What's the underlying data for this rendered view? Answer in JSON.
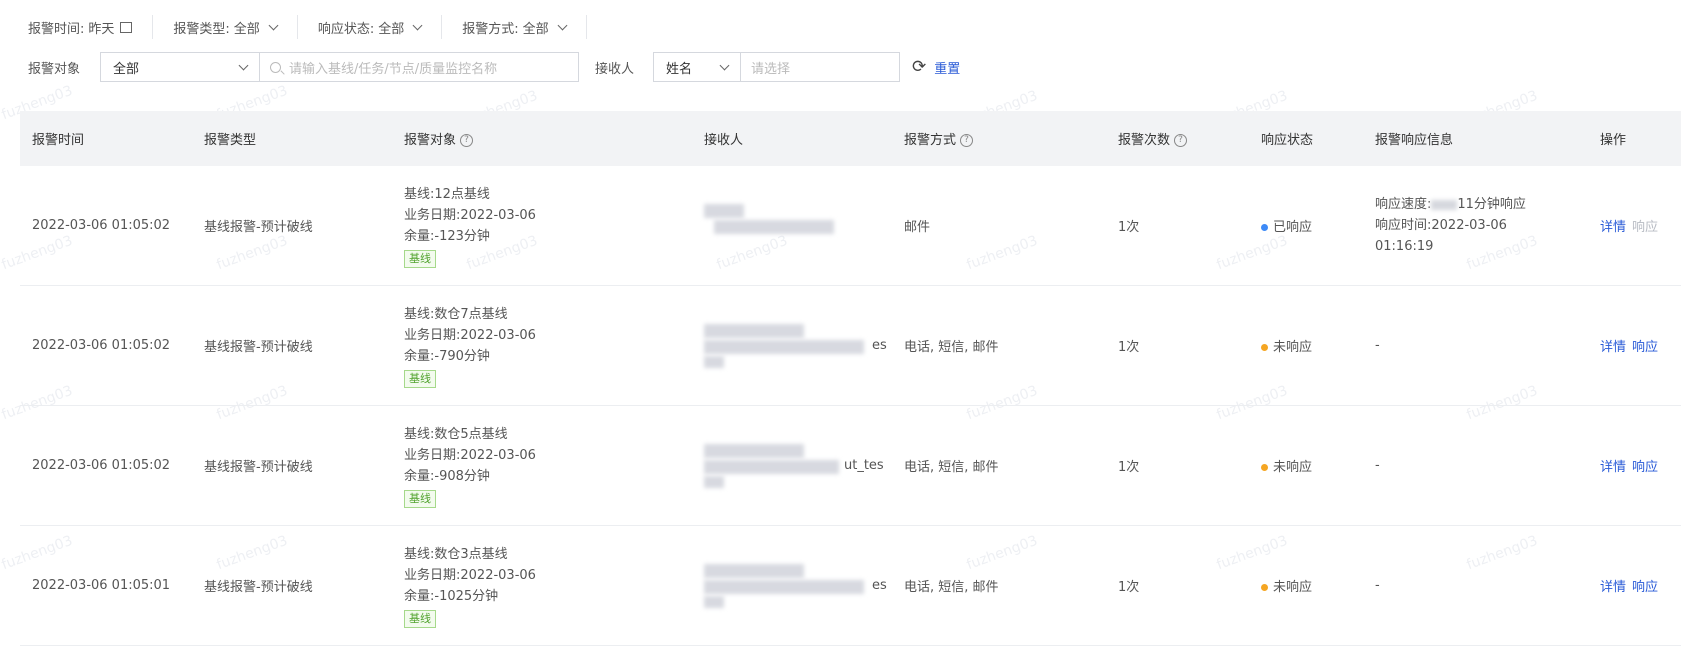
{
  "filters": {
    "time": {
      "label": "报警时间:",
      "value": "昨天"
    },
    "type": {
      "label": "报警类型:",
      "value": "全部"
    },
    "status": {
      "label": "响应状态:",
      "value": "全部"
    },
    "method": {
      "label": "报警方式:",
      "value": "全部"
    },
    "target": {
      "label": "报警对象",
      "value": "全部",
      "placeholder": "请输入基线/任务/节点/质量监控名称"
    },
    "receiver": {
      "label": "接收人",
      "type_value": "姓名",
      "placeholder": "请选择"
    },
    "reset_label": "重置"
  },
  "table": {
    "headers": [
      "报警时间",
      "报警类型",
      "报警对象",
      "接收人",
      "报警方式",
      "报警次数",
      "响应状态",
      "报警响应信息",
      "操作"
    ],
    "rows": [
      {
        "time": "2022-03-06 01:05:02",
        "type": "基线报警-预计破线",
        "baseline": "基线:12点基线",
        "date": "业务日期:2022-03-06",
        "remain": "余量:-123分钟",
        "tag": "基线",
        "receiver_suffix": "",
        "method": "邮件",
        "count": "1次",
        "status": "已响应",
        "status_color": "#3d8af7",
        "info_speed": "响应速度:",
        "info_speed_rest": "11分钟响应",
        "info_time": "响应时间:2022-03-06 01:16:19",
        "op_detail": "详情",
        "op_respond": "响应",
        "respond_disabled": true
      },
      {
        "time": "2022-03-06 01:05:02",
        "type": "基线报警-预计破线",
        "baseline": "基线:数仓7点基线",
        "date": "业务日期:2022-03-06",
        "remain": "余量:-790分钟",
        "tag": "基线",
        "receiver_suffix": "es",
        "method": "电话, 短信, 邮件",
        "count": "1次",
        "status": "未响应",
        "status_color": "#f5a623",
        "info": "-",
        "op_detail": "详情",
        "op_respond": "响应",
        "respond_disabled": false
      },
      {
        "time": "2022-03-06 01:05:02",
        "type": "基线报警-预计破线",
        "baseline": "基线:数仓5点基线",
        "date": "业务日期:2022-03-06",
        "remain": "余量:-908分钟",
        "tag": "基线",
        "receiver_suffix": "ut_tes",
        "method": "电话, 短信, 邮件",
        "count": "1次",
        "status": "未响应",
        "status_color": "#f5a623",
        "info": "-",
        "op_detail": "详情",
        "op_respond": "响应",
        "respond_disabled": false
      },
      {
        "time": "2022-03-06 01:05:01",
        "type": "基线报警-预计破线",
        "baseline": "基线:数仓3点基线",
        "date": "业务日期:2022-03-06",
        "remain": "余量:-1025分钟",
        "tag": "基线",
        "receiver_suffix": "es",
        "method": "电话, 短信, 邮件",
        "count": "1次",
        "status": "未响应",
        "status_color": "#f5a623",
        "info": "-",
        "op_detail": "详情",
        "op_respond": "响应",
        "respond_disabled": false
      }
    ]
  },
  "icons": {
    "calendar": "calendar-icon",
    "chevron": "chevron-down-icon",
    "search": "search-icon",
    "reset": "refresh-icon",
    "help": "help-circle-icon"
  }
}
